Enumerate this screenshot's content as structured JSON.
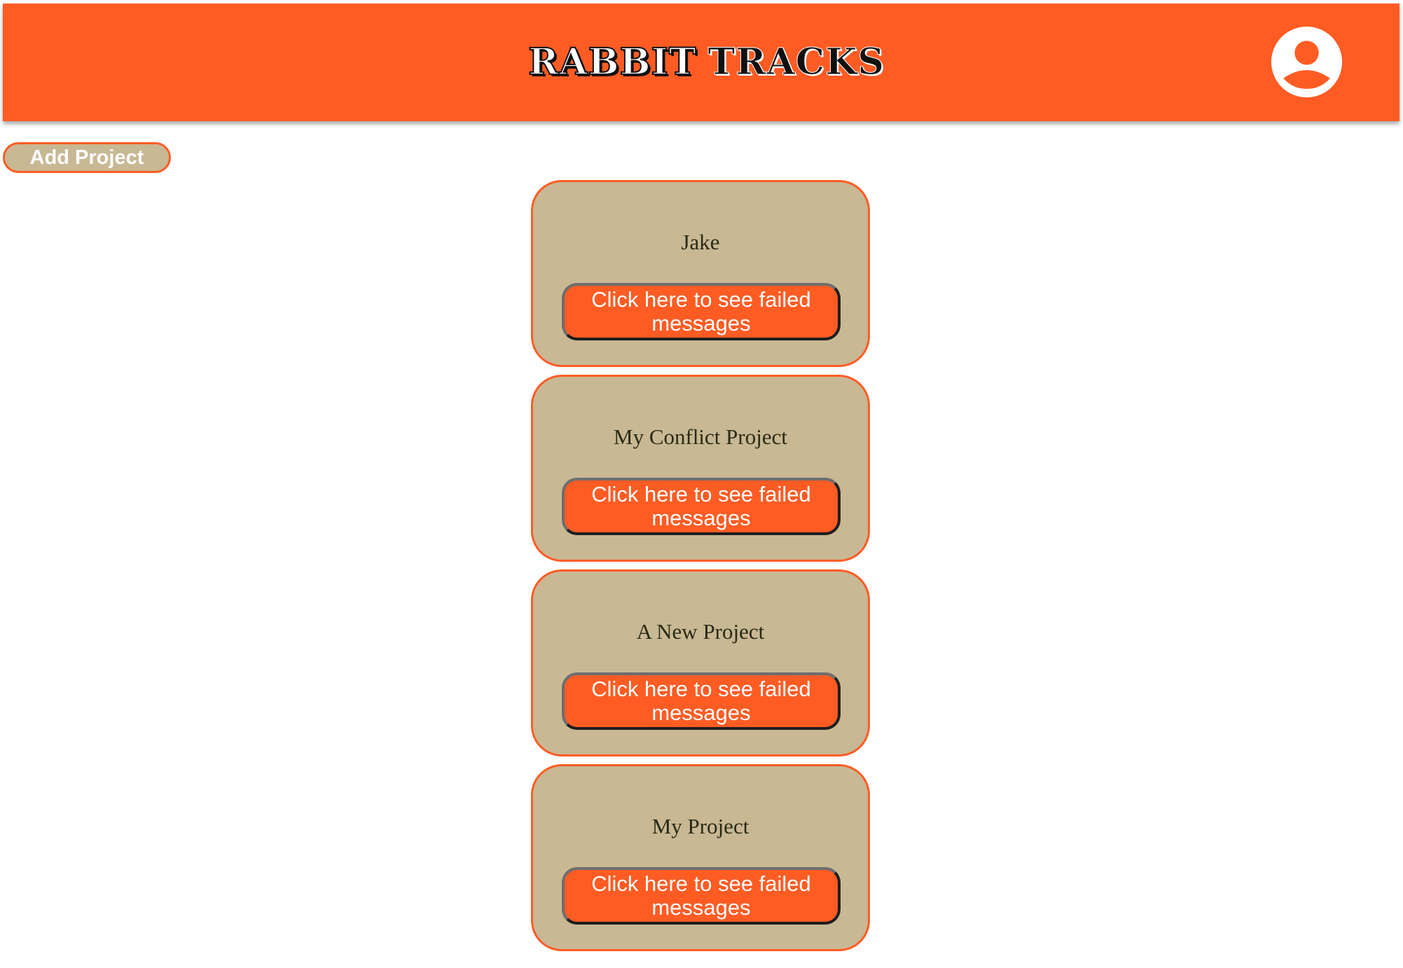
{
  "header": {
    "brand_part1": "RABBIT",
    "brand_part2": "TRACKS",
    "avatar_icon": "user-circle-icon",
    "background_color": "#ff5c24"
  },
  "toolbar": {
    "add_project_label": "Add Project"
  },
  "projects": [
    {
      "name": "Jake",
      "button_label": "Click here to see failed messages"
    },
    {
      "name": "My Conflict Project",
      "button_label": "Click here to see failed messages"
    },
    {
      "name": "A New Project",
      "button_label": "Click here to see failed messages"
    },
    {
      "name": "My Project",
      "button_label": "Click here to see failed messages"
    }
  ],
  "colors": {
    "accent": "#ff5c24",
    "card": "#c8b894",
    "text": "#2a2a14"
  }
}
